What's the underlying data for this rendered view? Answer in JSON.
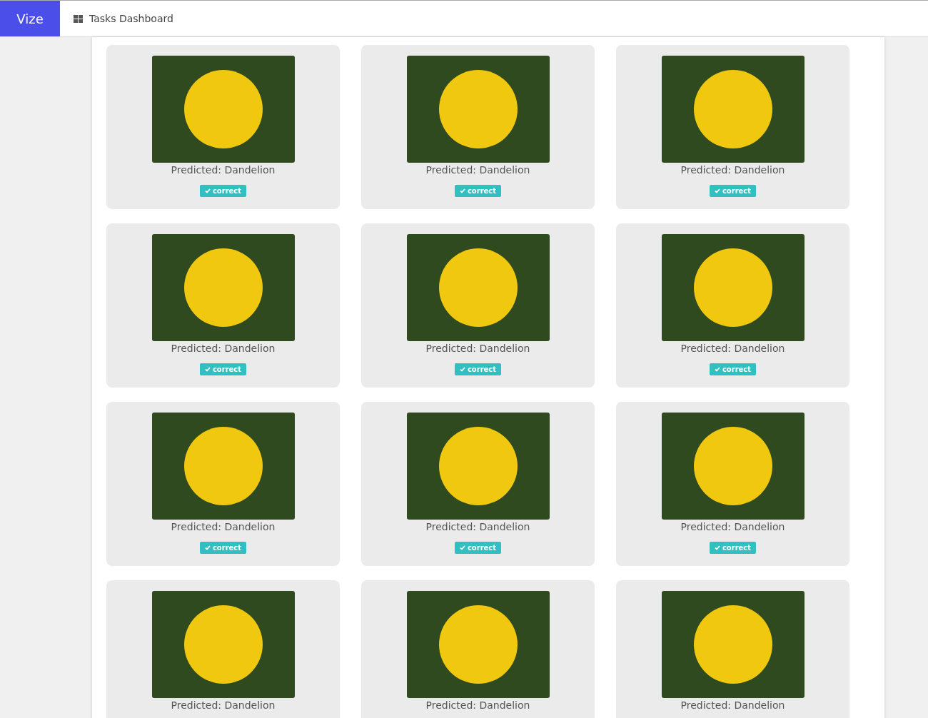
{
  "brand": "Vize",
  "nav": {
    "label": "Tasks Dashboard"
  },
  "predictions": [
    {
      "caption": "Predicted: Dandelion",
      "badge": {
        "label": "correct"
      }
    },
    {
      "caption": "Predicted: Dandelion",
      "badge": {
        "label": "correct"
      }
    },
    {
      "caption": "Predicted: Dandelion",
      "badge": {
        "label": "correct"
      }
    },
    {
      "caption": "Predicted: Dandelion",
      "badge": {
        "label": "correct"
      }
    },
    {
      "caption": "Predicted: Dandelion",
      "badge": {
        "label": "correct"
      }
    },
    {
      "caption": "Predicted: Dandelion",
      "badge": {
        "label": "correct"
      }
    },
    {
      "caption": "Predicted: Dandelion",
      "badge": {
        "label": "correct"
      }
    },
    {
      "caption": "Predicted: Dandelion",
      "badge": {
        "label": "correct"
      }
    },
    {
      "caption": "Predicted: Dandelion",
      "badge": {
        "label": "correct"
      }
    },
    {
      "caption": "Predicted: Dandelion"
    },
    {
      "caption": "Predicted: Dandelion"
    },
    {
      "caption": "Predicted: Dandelion"
    }
  ]
}
